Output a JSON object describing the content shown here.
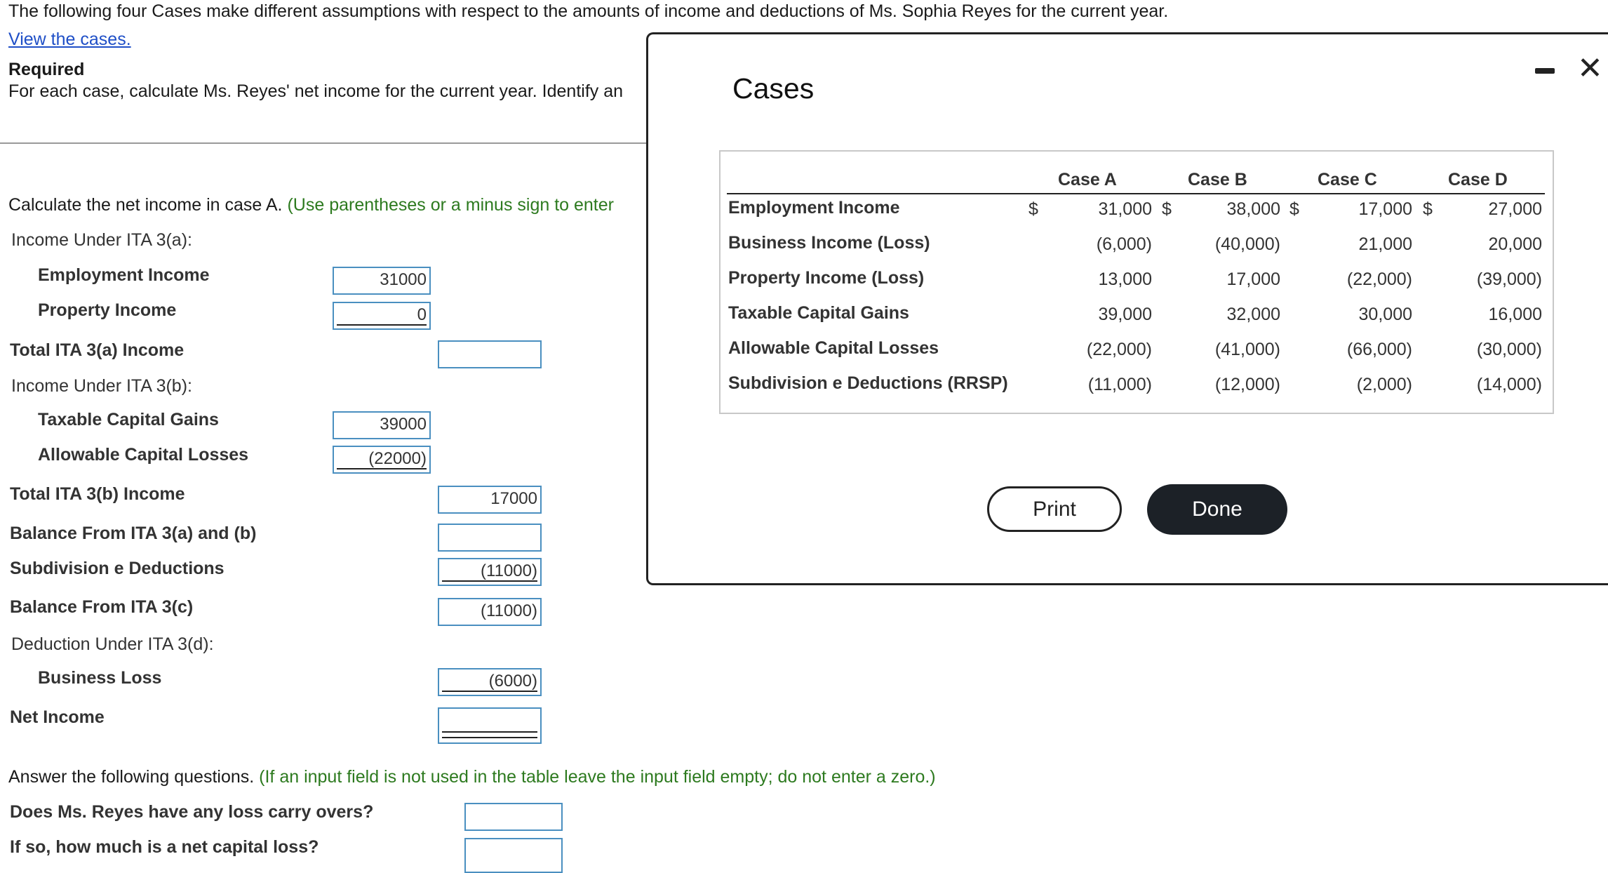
{
  "intro": "The following four Cases make different assumptions with respect to the amounts of income and deductions of Ms. Sophia Reyes for the current year.",
  "view_cases_link": "View the cases.",
  "required": {
    "title": "Required",
    "text": "For each case, calculate Ms. Reyes' net income for the current year. Identify an"
  },
  "calc": {
    "instruction": "Calculate the net income in case A.",
    "hint": "(Use parentheses or a minus sign to enter",
    "rows": {
      "income_3a": "Income Under ITA 3(a):",
      "employment_income": "Employment Income",
      "property_income": "Property Income",
      "total_3a": "Total ITA 3(a) Income",
      "income_3b": "Income Under ITA 3(b):",
      "taxable_capital_gains": "Taxable Capital Gains",
      "allowable_capital_losses": "Allowable Capital Losses",
      "total_3b": "Total ITA 3(b) Income",
      "balance_3ab": "Balance From ITA 3(a) and (b)",
      "subdivision_e": "Subdivision e Deductions",
      "balance_3c": "Balance From ITA 3(c)",
      "deduction_3d": "Deduction Under ITA 3(d):",
      "business_loss": "Business Loss",
      "net_income": "Net Income"
    },
    "values": {
      "employment_income": "31000",
      "property_income": "0",
      "total_3a": "",
      "taxable_capital_gains": "39000",
      "allowable_capital_losses": "(22000)",
      "total_3b": "17000",
      "balance_3ab": "",
      "subdivision_e": "(11000)",
      "balance_3c": "(11000)",
      "business_loss": "(6000)",
      "net_income": ""
    }
  },
  "questions": {
    "intro": "Answer the following questions.",
    "hint": "(If an input field is not used in the table leave the input field empty; do not enter a zero.)",
    "q1": "Does Ms. Reyes have any loss carry overs?",
    "q2": "If so, how much is a net capital loss?",
    "a1": "",
    "a2": ""
  },
  "modal": {
    "title": "Cases",
    "headers": [
      "Case A",
      "Case B",
      "Case C",
      "Case D"
    ],
    "rows": [
      {
        "label": "Employment Income",
        "values": [
          "31,000",
          "38,000",
          "17,000",
          "27,000"
        ]
      },
      {
        "label": "Business Income (Loss)",
        "values": [
          "(6,000)",
          "(40,000)",
          "21,000",
          "20,000"
        ]
      },
      {
        "label": "Property Income (Loss)",
        "values": [
          "13,000",
          "17,000",
          "(22,000)",
          "(39,000)"
        ]
      },
      {
        "label": "Taxable Capital Gains",
        "values": [
          "39,000",
          "32,000",
          "30,000",
          "16,000"
        ]
      },
      {
        "label": "Allowable Capital Losses",
        "values": [
          "(22,000)",
          "(41,000)",
          "(66,000)",
          "(30,000)"
        ]
      },
      {
        "label": "Subdivision e Deductions (RRSP)",
        "values": [
          "(11,000)",
          "(12,000)",
          "(2,000)",
          "(14,000)"
        ]
      }
    ],
    "currency": "$",
    "print_label": "Print",
    "done_label": "Done"
  },
  "colors": {
    "link": "#1f4fc7",
    "hint_green": "#2d7a1f",
    "field_border": "#4a8fc0",
    "done_button": "#1c2127"
  }
}
